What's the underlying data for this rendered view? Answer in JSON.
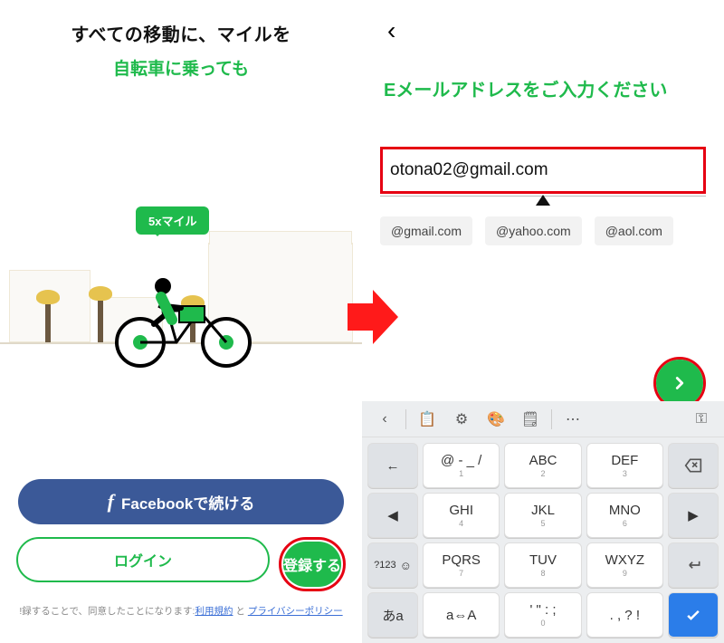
{
  "left": {
    "title": "すべての移動に、マイルを",
    "subtitle": "自転車に乗っても",
    "badge": "5xマイル",
    "facebook_label": "Facebookで続ける",
    "login_label": "ログイン",
    "register_label": "登録する",
    "terms_prefix": "!録することで、同意したことになります:",
    "terms_link1": "利用規約",
    "terms_and": " と ",
    "terms_link2": "プライバシーポリシー"
  },
  "right": {
    "prompt": "Eメールアドレスをご入力ください",
    "email_value": "otona02@gmail.com",
    "suggestions": [
      "@gmail.com",
      "@yahoo.com",
      "@aol.com"
    ]
  },
  "keyboard": {
    "rows": [
      [
        "←",
        "@ - _ /",
        "ABC",
        "DEF",
        "⌫"
      ],
      [
        "◀",
        "GHI",
        "JKL",
        "MNO",
        "▶"
      ],
      [
        "?123",
        "PQRS",
        "TUV",
        "WXYZ",
        "⏎"
      ],
      [
        "あa",
        "a⇔A",
        "' \" : ;",
        ". , ? !",
        "✓"
      ]
    ],
    "subs": {
      "@ - _ /": "1",
      "ABC": "2",
      "DEF": "3",
      "GHI": "4",
      "JKL": "5",
      "MNO": "6",
      "PQRS": "7",
      "TUV": "8",
      "WXYZ": "9",
      "' \" : ;": "0"
    }
  }
}
